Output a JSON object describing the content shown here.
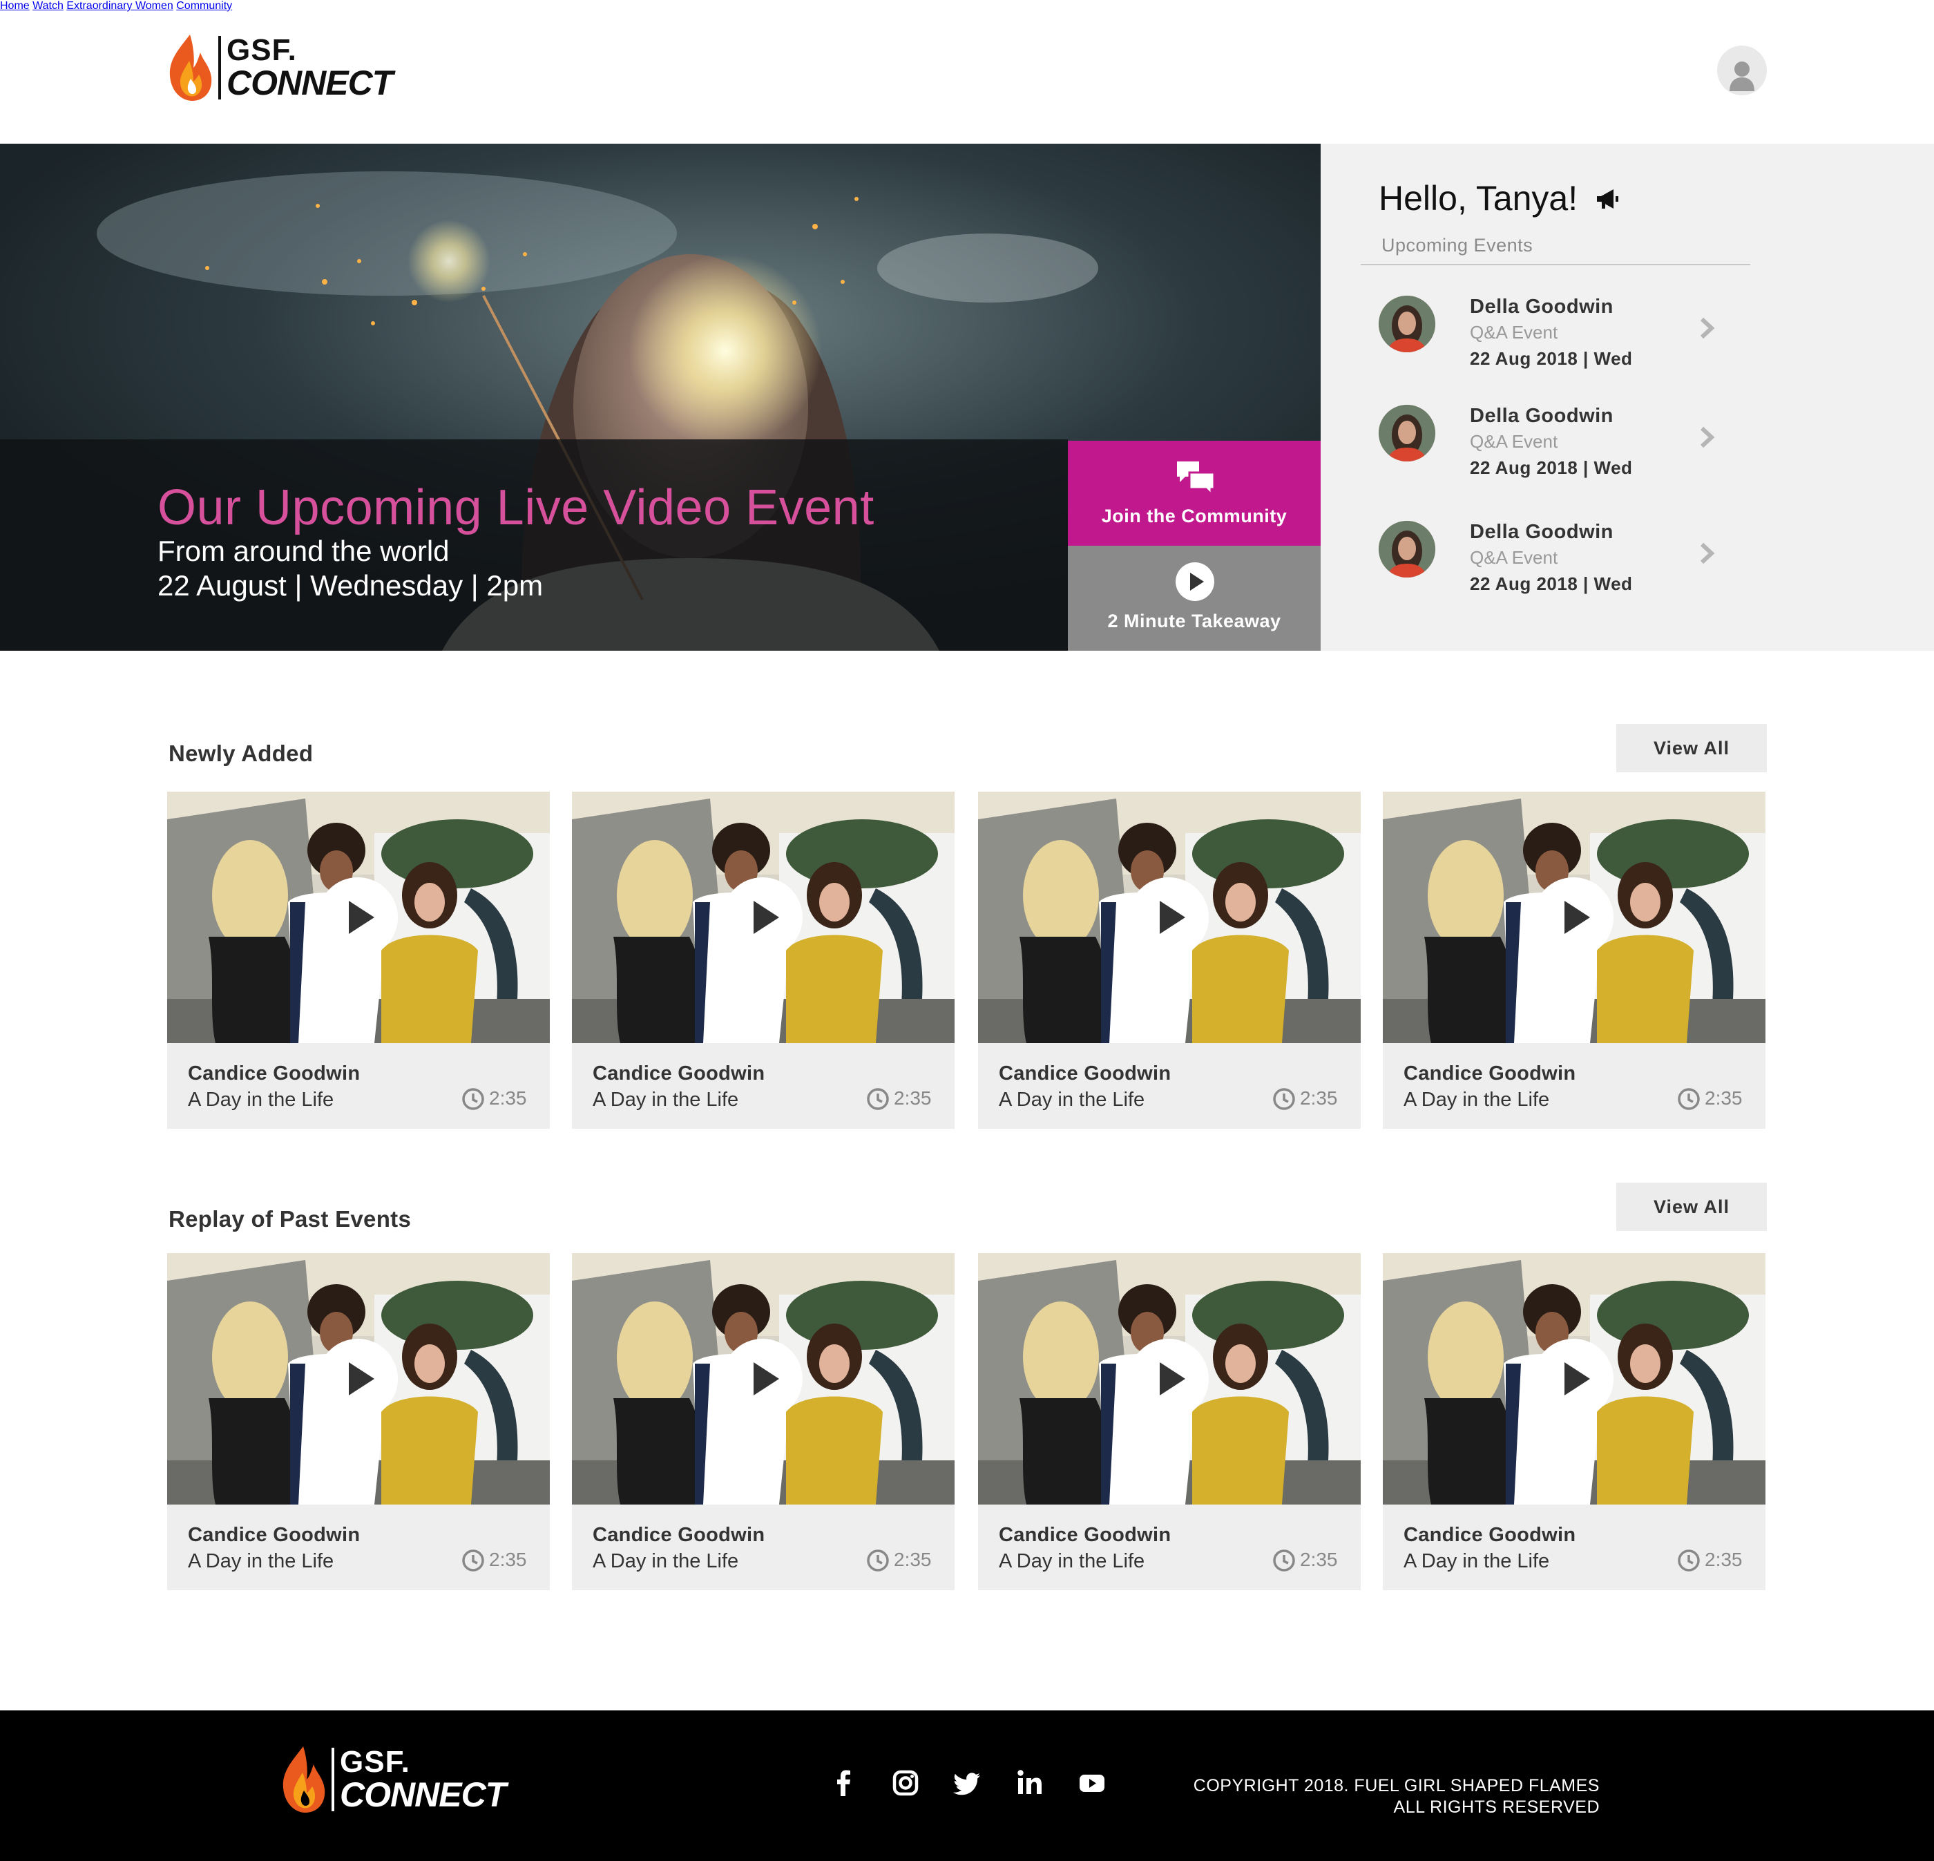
{
  "logo": {
    "line1": "GSF.",
    "line2": "CONNECT"
  },
  "nav": {
    "items": [
      {
        "label": "Home"
      },
      {
        "label": "Watch"
      },
      {
        "label": "Extraordinary Women"
      },
      {
        "label": "Community"
      }
    ],
    "avatar_icon": "user-icon"
  },
  "hero": {
    "title": "Our Upcoming Live Video Event",
    "subtitle": "From around the world",
    "date": "22 August | Wednesday | 2pm",
    "join_label": "Join the Community",
    "join_icon": "chat-bubbles-icon",
    "takeaway_label": "2 Minute Takeaway",
    "takeaway_icon": "play-icon",
    "colors": {
      "title": "#d6509c",
      "join_bg": "#c2188e",
      "takeaway_bg": "#8a8a8a"
    }
  },
  "sidebar": {
    "greeting": "Hello, Tanya!",
    "greeting_icon": "megaphone-icon",
    "section_title": "Upcoming Events",
    "events": [
      {
        "name": "Della Goodwin",
        "type": "Q&A Event",
        "date": "22 Aug 2018 | Wed"
      },
      {
        "name": "Della Goodwin",
        "type": "Q&A Event",
        "date": "22 Aug 2018 | Wed"
      },
      {
        "name": "Della Goodwin",
        "type": "Q&A Event",
        "date": "22 Aug 2018 | Wed"
      }
    ]
  },
  "newly_added": {
    "title": "Newly Added",
    "view_all": "View All",
    "cards": [
      {
        "name": "Candice Goodwin",
        "subtitle": "A Day in the Life",
        "duration": "2:35"
      },
      {
        "name": "Candice Goodwin",
        "subtitle": "A Day in the Life",
        "duration": "2:35"
      },
      {
        "name": "Candice Goodwin",
        "subtitle": "A Day in the Life",
        "duration": "2:35"
      },
      {
        "name": "Candice Goodwin",
        "subtitle": "A Day in the Life",
        "duration": "2:35"
      }
    ]
  },
  "replay": {
    "title": "Replay of Past Events",
    "view_all": "View All",
    "cards": [
      {
        "name": "Candice Goodwin",
        "subtitle": "A Day in the Life",
        "duration": "2:35"
      },
      {
        "name": "Candice Goodwin",
        "subtitle": "A Day in the Life",
        "duration": "2:35"
      },
      {
        "name": "Candice Goodwin",
        "subtitle": "A Day in the Life",
        "duration": "2:35"
      },
      {
        "name": "Candice Goodwin",
        "subtitle": "A Day in the Life",
        "duration": "2:35"
      }
    ]
  },
  "footer": {
    "social_icons": [
      "facebook-icon",
      "instagram-icon",
      "twitter-icon",
      "linkedin-icon",
      "youtube-icon"
    ],
    "copyright_line1": "COPYRIGHT 2018. FUEL GIRL SHAPED FLAMES",
    "copyright_line2": "ALL RIGHTS RESERVED"
  }
}
